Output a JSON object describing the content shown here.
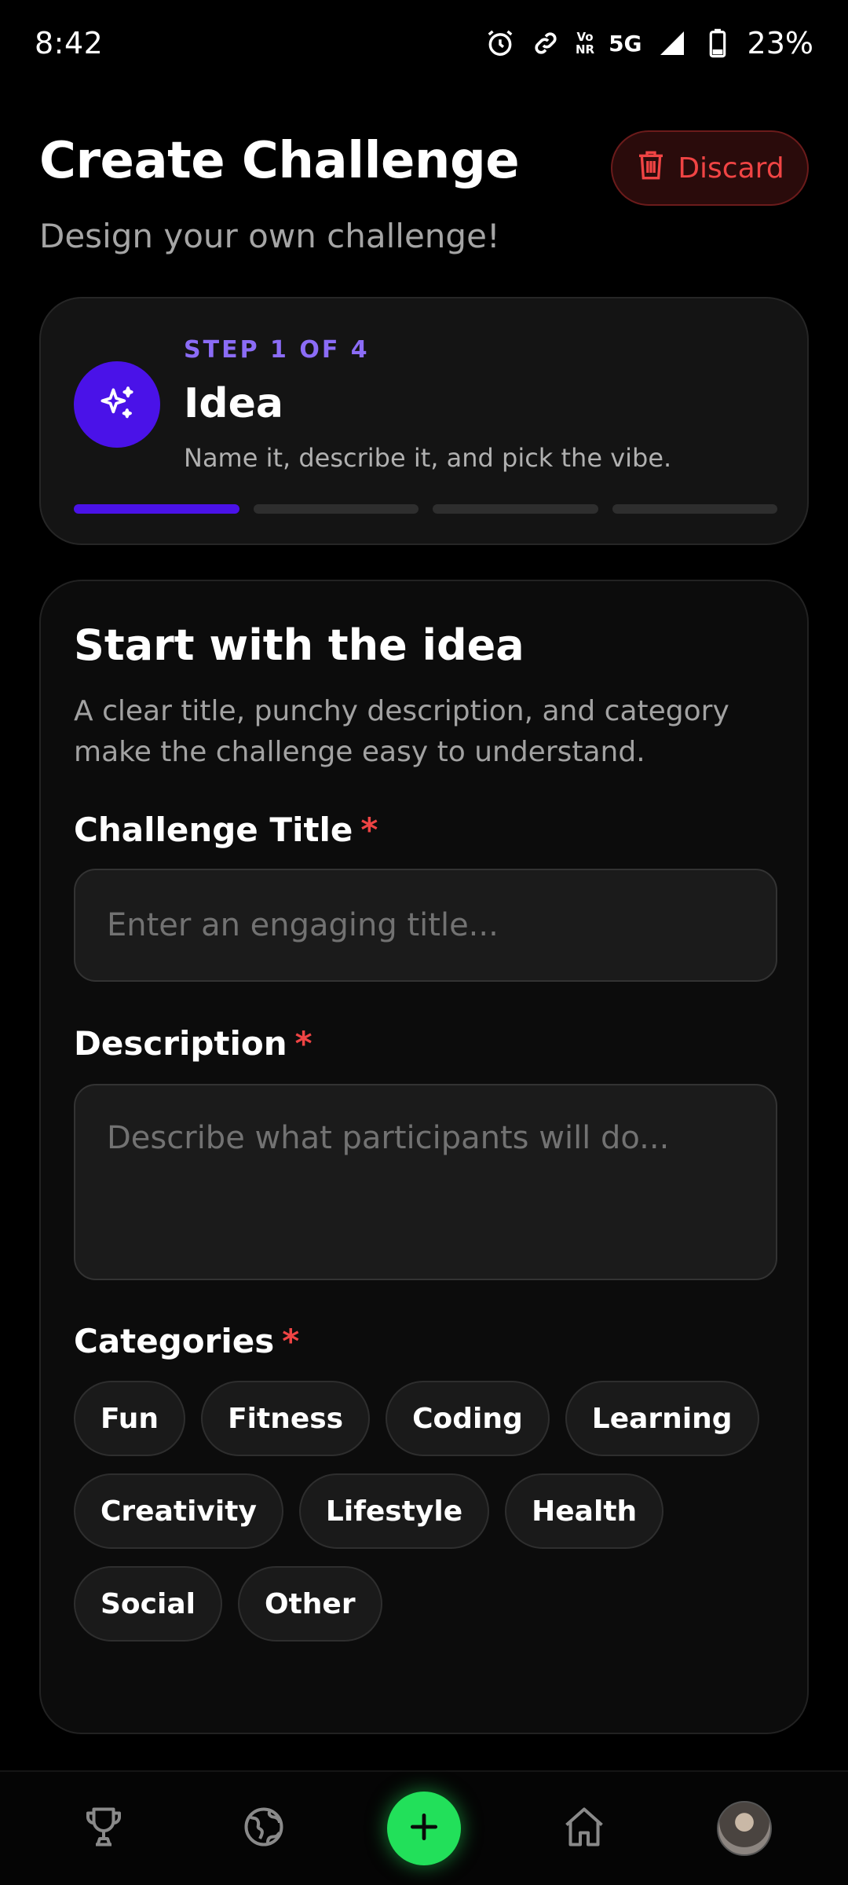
{
  "status_bar": {
    "time": "8:42",
    "network_top": "Vo",
    "network_bottom": "NR",
    "network_type": "5G",
    "battery": "23%"
  },
  "header": {
    "title": "Create Challenge",
    "subtitle": "Design your own challenge!",
    "discard_label": "Discard"
  },
  "step": {
    "label": "STEP 1 OF 4",
    "name": "Idea",
    "description": "Name it, describe it, and pick the vibe.",
    "current": 1,
    "total": 4
  },
  "form": {
    "title": "Start with the idea",
    "description": "A clear title, punchy description, and category make the challenge easy to understand.",
    "title_field": {
      "label": "Challenge Title",
      "required_mark": "*",
      "placeholder": "Enter an engaging title...",
      "value": ""
    },
    "description_field": {
      "label": "Description",
      "required_mark": "*",
      "placeholder": "Describe what participants will do...",
      "value": ""
    },
    "categories_field": {
      "label": "Categories",
      "required_mark": "*",
      "options": [
        "Fun",
        "Fitness",
        "Coding",
        "Learning",
        "Creativity",
        "Lifestyle",
        "Health",
        "Social",
        "Other"
      ]
    }
  },
  "bottom_nav": {
    "items": [
      "trophy-icon",
      "globe-icon",
      "add-icon",
      "home-icon",
      "avatar"
    ]
  },
  "colors": {
    "accent": "#4a12e8",
    "step_label": "#8b6cf6",
    "danger": "#ef4444",
    "add_button": "#22e05a"
  }
}
